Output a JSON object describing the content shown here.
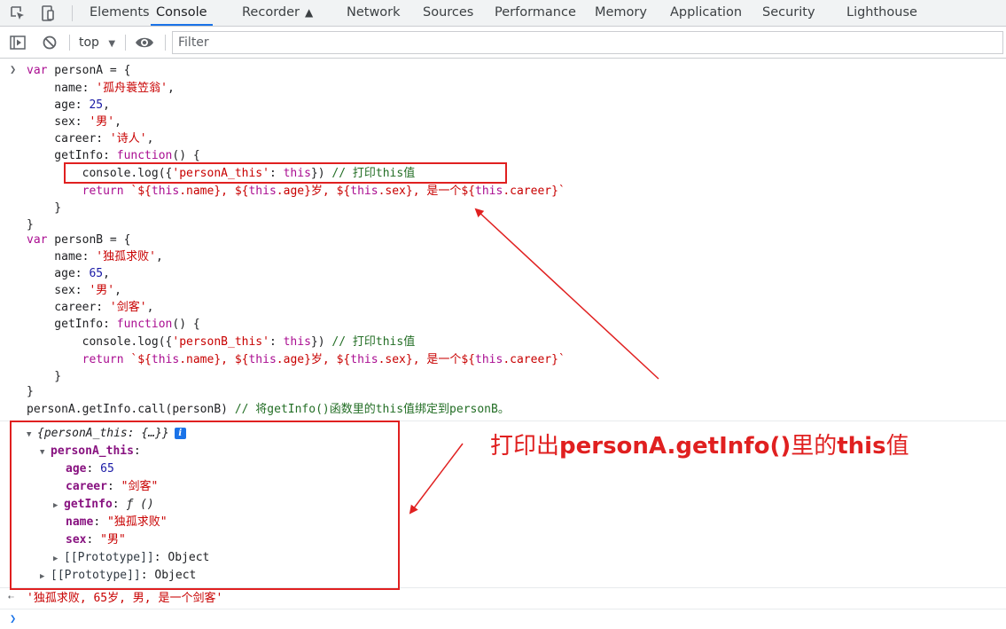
{
  "tabs": [
    {
      "label": "Elements"
    },
    {
      "label": "Console",
      "active": true
    },
    {
      "label": "Recorder"
    },
    {
      "label": "Network"
    },
    {
      "label": "Sources"
    },
    {
      "label": "Performance"
    },
    {
      "label": "Memory"
    },
    {
      "label": "Application"
    },
    {
      "label": "Security"
    },
    {
      "label": "Lighthouse"
    }
  ],
  "toolbar": {
    "context": "top",
    "filter_placeholder": "Filter",
    "filter_value": ""
  },
  "code": {
    "a_decl_kw": "var",
    "a_decl_rest": " personA = {",
    "a_name_key": "    name: ",
    "a_name_val": "'孤舟蓑笠翁'",
    "a_age_key": "    age: ",
    "a_age_val": "25",
    "a_sex_key": "    sex: ",
    "a_sex_val": "'男'",
    "a_career_key": "    career: ",
    "a_career_val": "'诗人'",
    "a_getinfo_key": "    getInfo: ",
    "a_getinfo_fn": "function",
    "a_getinfo_rest": "() {",
    "a_log_pre": "        console.log({",
    "a_log_str": "'personA_this'",
    "a_log_mid": ": ",
    "a_log_this": "this",
    "a_log_post": "}) ",
    "a_log_comment": "// 打印this值",
    "a_ret_kw": "        return ",
    "a_ret_t1": "`${",
    "a_ret_this1": "this",
    "a_ret_p1": ".name}, ${",
    "a_ret_this2": "this",
    "a_ret_p2": ".age}岁, ${",
    "a_ret_this3": "this",
    "a_ret_p3": ".sex}, 是一个${",
    "a_ret_this4": "this",
    "a_ret_p4": ".career}`",
    "a_close_fn": "    }",
    "a_close_obj": "}",
    "b_decl_kw": "var",
    "b_decl_rest": " personB = {",
    "b_name_key": "    name: ",
    "b_name_val": "'独孤求败'",
    "b_age_key": "    age: ",
    "b_age_val": "65",
    "b_sex_key": "    sex: ",
    "b_sex_val": "'男'",
    "b_career_key": "    career: ",
    "b_career_val": "'剑客'",
    "b_getinfo_key": "    getInfo: ",
    "b_getinfo_fn": "function",
    "b_getinfo_rest": "() {",
    "b_log_pre": "        console.log({",
    "b_log_str": "'personB_this'",
    "b_log_mid": ": ",
    "b_log_this": "this",
    "b_log_post": "}) ",
    "b_log_comment": "// 打印this值",
    "b_ret_kw": "        return ",
    "b_ret_t1": "`${",
    "b_ret_this1": "this",
    "b_ret_p1": ".name}, ${",
    "b_ret_this2": "this",
    "b_ret_p2": ".age}岁, ${",
    "b_ret_this3": "this",
    "b_ret_p3": ".sex}, 是一个${",
    "b_ret_this4": "this",
    "b_ret_p4": ".career}`",
    "b_close_fn": "    }",
    "b_close_obj": "}",
    "call_stmt": "personA.getInfo.call(personB) ",
    "call_comment": "// 将getInfo()函数里的this值绑定到personB。"
  },
  "log_output": {
    "summary": "{personA_this: {…}}",
    "info_badge": "i",
    "root_key": "personA_this",
    "root_colon": ":",
    "props": [
      {
        "key": "age",
        "value": "65",
        "kind": "number"
      },
      {
        "key": "career",
        "value": "\"剑客\"",
        "kind": "string"
      },
      {
        "key": "getInfo",
        "value": "ƒ ()",
        "kind": "function"
      },
      {
        "key": "name",
        "value": "\"独孤求败\"",
        "kind": "string"
      },
      {
        "key": "sex",
        "value": "\"男\"",
        "kind": "string"
      }
    ],
    "inner_proto_key": "[[Prototype]]",
    "inner_proto_val": "Object",
    "outer_proto_key": "[[Prototype]]",
    "outer_proto_val": "Object"
  },
  "result": "'独孤求败, 65岁, 男, 是一个剑客'",
  "annotation": {
    "part1": "打印出",
    "part2": "personA.getInfo()",
    "part3": "里的",
    "part4": "this",
    "part5": "值"
  },
  "colors": {
    "accent": "#1a73e8",
    "annotation_red": "#e02020",
    "string": "#c80000",
    "keyword": "#aa0d91",
    "comment": "#236e25"
  }
}
